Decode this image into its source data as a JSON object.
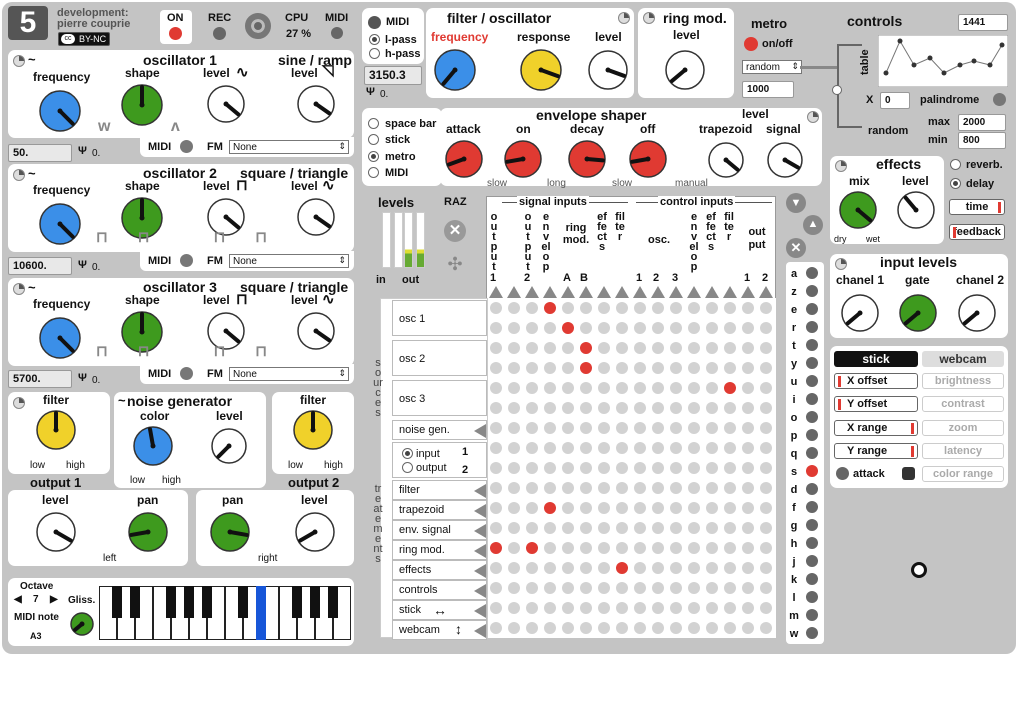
{
  "header": {
    "logo": "5",
    "dev_line1": "development:",
    "dev_line2": "pierre couprie",
    "license": "BY-NC",
    "on_label": "ON",
    "rec_label": "REC",
    "cpu_label": "CPU",
    "cpu_value": "27 %",
    "midi_label": "MIDI"
  },
  "osc1": {
    "title": "oscillator 1",
    "frequency": "frequency",
    "shape": "shape",
    "level": "level",
    "wave_title": "sine / ramp",
    "wave_level": "level",
    "freq_value": "50.",
    "tune_value": "0.",
    "midi": "MIDI",
    "fm": "FM",
    "fm_value": "None"
  },
  "osc2": {
    "title": "oscillator 2",
    "frequency": "frequency",
    "shape": "shape",
    "level": "level",
    "wave_title": "square / triangle",
    "wave_level": "level",
    "freq_value": "10600.",
    "tune_value": "0.",
    "midi": "MIDI",
    "fm": "FM",
    "fm_value": "None"
  },
  "osc3": {
    "title": "oscillator 3",
    "frequency": "frequency",
    "shape": "shape",
    "level": "level",
    "wave_title": "square / triangle",
    "wave_level": "level",
    "freq_value": "5700.",
    "tune_value": "0.",
    "midi": "MIDI",
    "fm": "FM",
    "fm_value": "None"
  },
  "noise": {
    "filter1": "filter",
    "low": "low",
    "high": "high",
    "output1": "output 1",
    "title": "noise generator",
    "color": "color",
    "level": "level",
    "filter2": "filter",
    "output2": "output 2",
    "level_l": "level",
    "pan_l": "pan",
    "left": "left",
    "pan_r": "pan",
    "level_r": "level",
    "right": "right"
  },
  "keyboard": {
    "octave": "Octave",
    "octave_value": "7",
    "midi_note": "MIDI note",
    "note": "A3",
    "gliss": "Gliss."
  },
  "filter": {
    "midi": "MIDI",
    "lpass": "l-pass",
    "hpass": "h-pass",
    "value": "3150.3",
    "tune": "0.",
    "title": "filter / oscillator",
    "frequency": "frequency",
    "response": "response",
    "level": "level"
  },
  "ring": {
    "title": "ring mod.",
    "level": "level"
  },
  "metro": {
    "title": "metro",
    "onoff": "on/off",
    "mode": "random",
    "interval": "1000"
  },
  "controls": {
    "title": "controls",
    "value": "1441",
    "table": "table",
    "x_label": "X",
    "x_value": "0",
    "palindrome": "palindrome",
    "random": "random",
    "max": "max",
    "max_value": "2000",
    "min": "min",
    "min_value": "800"
  },
  "envelope": {
    "title": "envelope shaper",
    "sources": [
      "space bar",
      "stick",
      "metro",
      "MIDI"
    ],
    "attack": "attack",
    "on": "on",
    "decay": "decay",
    "off": "off",
    "level": "level",
    "trapezoid": "trapezoid",
    "signal": "signal",
    "slow1": "slow",
    "long": "long",
    "slow2": "slow",
    "manual": "manual"
  },
  "effects": {
    "title": "effects",
    "mix": "mix",
    "level": "level",
    "dry": "dry",
    "wet": "wet",
    "reverb": "reverb.",
    "delay": "delay",
    "time": "time",
    "feedback": "feedback"
  },
  "levels": {
    "title": "levels",
    "in": "in",
    "out": "out",
    "raz": "RAZ"
  },
  "matrix": {
    "signal_inputs": "signal inputs",
    "control_inputs": "control inputs",
    "columns": [
      "output",
      "1",
      "output",
      "2",
      "envelop",
      "ring mod.",
      "A",
      "B",
      "effects",
      "filter",
      "osc.",
      "1",
      "2",
      "3",
      "envelop",
      "effects",
      "filter",
      "out put",
      "1",
      "2"
    ],
    "sources": "sources",
    "treatements": "treatements",
    "rows": [
      "osc 1",
      "osc 2",
      "osc 3",
      "noise gen.",
      "input",
      "output",
      "1",
      "2",
      "filter",
      "trapezoid",
      "env. signal",
      "ring mod.",
      "effects",
      "controls",
      "stick",
      "webcam"
    ],
    "letters": [
      "a",
      "z",
      "e",
      "r",
      "t",
      "y",
      "u",
      "i",
      "o",
      "p",
      "q",
      "s",
      "d",
      "f",
      "g",
      "h",
      "j",
      "k",
      "l",
      "m",
      "w"
    ]
  },
  "inputlevels": {
    "title": "input levels",
    "ch1": "chanel 1",
    "gate": "gate",
    "ch2": "chanel 2"
  },
  "stickcam": {
    "stick": "stick",
    "webcam": "webcam",
    "xoffset": "X offset",
    "yoffset": "Y offset",
    "xrange": "X range",
    "yrange": "Y range",
    "attack": "attack",
    "brightness": "brightness",
    "contrast": "contrast",
    "zoom": "zoom",
    "latency": "latency",
    "colorrange": "color range"
  },
  "colors": {
    "blue": "#3b8fe8",
    "green": "#3e9a1e",
    "yellow": "#f0d12a",
    "red": "#e03a32",
    "panel": "#c4c4c4"
  }
}
